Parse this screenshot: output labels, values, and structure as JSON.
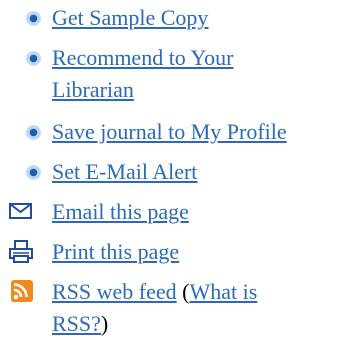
{
  "links": {
    "sample_copy": "Get Sample Copy",
    "recommend_line1": "Recommend to Your",
    "recommend_line2": "Librarian",
    "save_journal": "Save journal to My Profile",
    "email_alert": "Set E-Mail Alert",
    "email_page": "Email this page",
    "print_page": "Print this page",
    "rss_feed": "RSS web feed",
    "rss_open_paren": " (",
    "what_is_line1": "What is",
    "what_is_line2": "RSS?",
    "rss_close_paren": ")"
  },
  "icons": {
    "bullet": "bullet-icon",
    "email": "envelope-icon",
    "print": "printer-icon",
    "rss": "rss-icon"
  },
  "colors": {
    "link": "#2a6ab8",
    "bullet": "#1f5ea8",
    "rss": "#f08a1c"
  }
}
